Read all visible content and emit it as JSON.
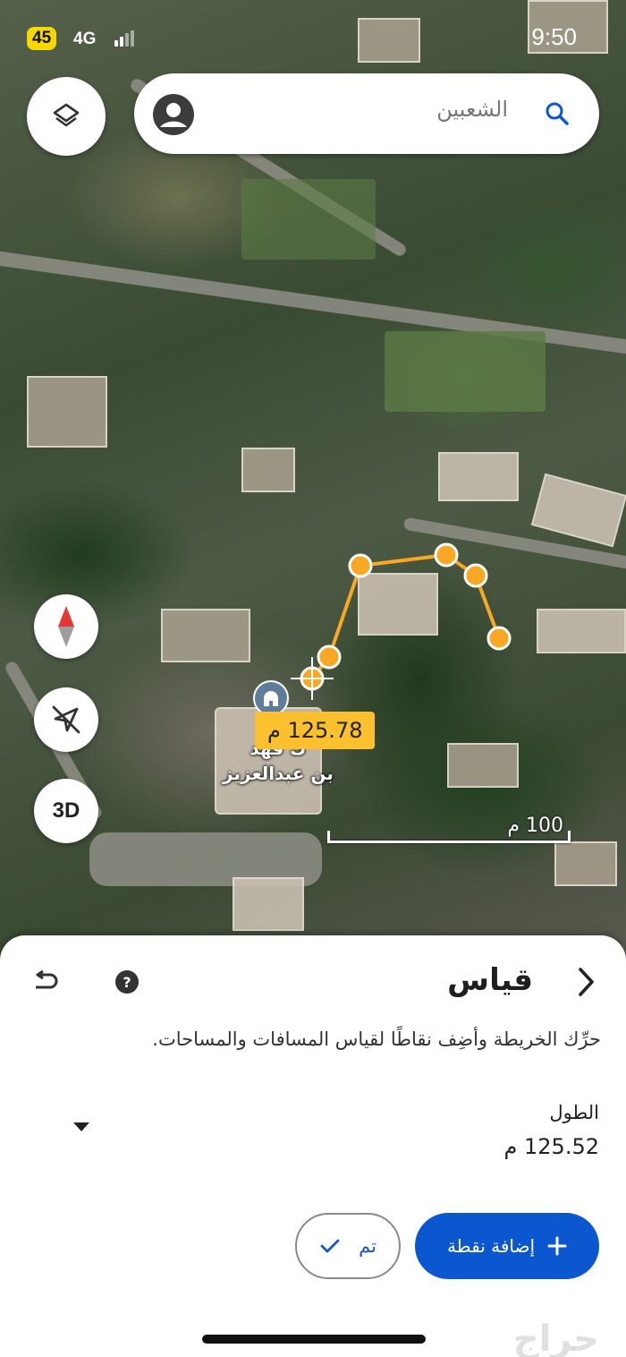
{
  "status_bar": {
    "battery": "45",
    "network": "4G",
    "time": "9:50"
  },
  "search": {
    "query": "الشعبين"
  },
  "map": {
    "compass": "compass-icon",
    "location_button": "location-off-icon",
    "view_3d_label": "3D",
    "measurement_label": "125.78 م",
    "place_label_line1": "ك فهد",
    "place_label_line2": "بن عبدالعزيز",
    "scale_label": "100 م",
    "measure_color": "#f9a825"
  },
  "sheet": {
    "title": "قياس",
    "instruction": "حرِّك الخريطة وأضِف نقاطًا لقياس المسافات والمساحات.",
    "length_label": "الطول",
    "length_value": "125.52 م",
    "done_label": "تم",
    "add_point_label": "إضافة نقطة",
    "accent_color": "#0b57d0"
  },
  "watermark": "حراج"
}
